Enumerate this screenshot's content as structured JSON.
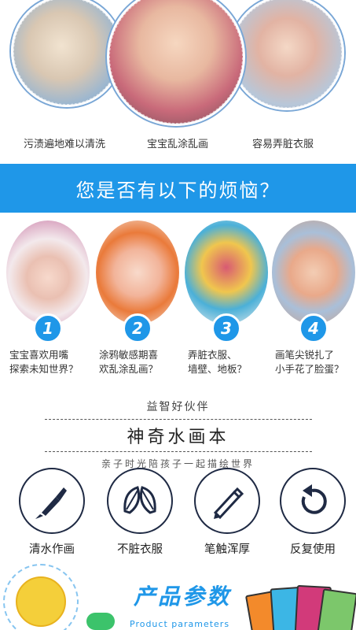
{
  "top_captions": [
    "污渍遍地难以清洗",
    "宝宝乱涂乱画",
    "容易弄脏衣服"
  ],
  "banner_text": "您是否有以下的烦恼？",
  "worries": [
    {
      "num": "1",
      "line1": "宝宝喜欢用嘴",
      "line2": "探索未知世界？"
    },
    {
      "num": "2",
      "line1": "涂鸦敏感期喜",
      "line2": "欢乱涂乱画？"
    },
    {
      "num": "3",
      "line1": "弄脏衣服、",
      "line2": "墙壁、地板？"
    },
    {
      "num": "4",
      "line1": "画笔尖锐扎了",
      "line2": "小手花了脸蛋？"
    }
  ],
  "partner": {
    "subtitle": "益智好伙伴",
    "title": "神奇水画本",
    "tagline": "亲子时光陪孩子一起描绘世界"
  },
  "features": [
    {
      "icon": "paintbrush-icon",
      "label": "清水作画"
    },
    {
      "icon": "leaves-icon",
      "label": "不脏衣服"
    },
    {
      "icon": "pencil-icon",
      "label": "笔触浑厚"
    },
    {
      "icon": "refresh-icon",
      "label": "反复使用"
    }
  ],
  "params": {
    "title": "产品参数",
    "subtitle": "Product parameters"
  },
  "colors": {
    "accent": "#1f97e8",
    "icon_stroke": "#1f2a44"
  }
}
